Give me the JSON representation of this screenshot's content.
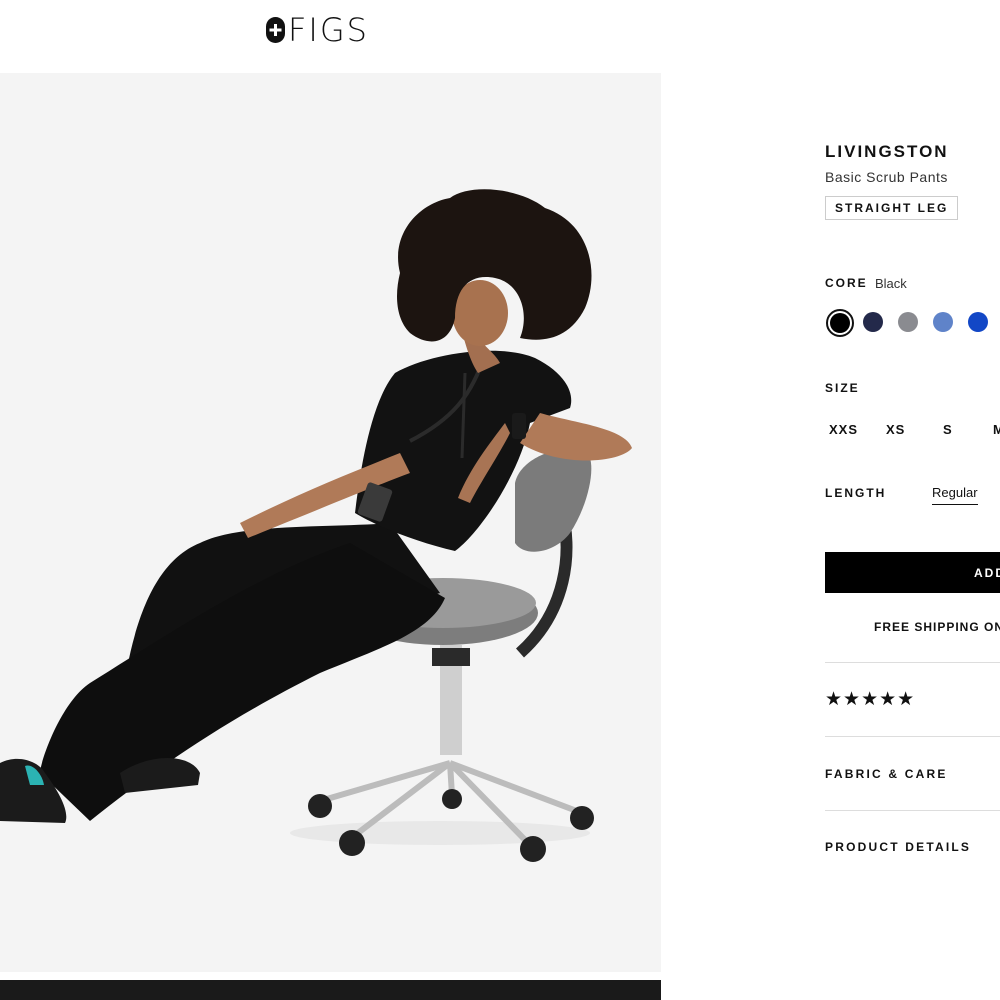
{
  "header": {
    "brand": "FIGS",
    "logo_icon": "figs-cross-logo-icon"
  },
  "product": {
    "name": "LIVINGSTON",
    "subtitle": "Basic Scrub Pants",
    "fit_badge": "STRAIGHT LEG",
    "image_alt": "model-seated-on-stool-photo"
  },
  "color": {
    "label": "CORE",
    "selected_name": "Black",
    "swatches": [
      {
        "name": "Black",
        "hex": "#000000",
        "selected": true
      },
      {
        "name": "Navy",
        "hex": "#23294a",
        "selected": false
      },
      {
        "name": "Graphite",
        "hex": "#8a8b90",
        "selected": false
      },
      {
        "name": "Ceil Blue",
        "hex": "#5f83c9",
        "selected": false
      },
      {
        "name": "Royal Blue",
        "hex": "#1247c6",
        "selected": false
      }
    ]
  },
  "size": {
    "label": "SIZE",
    "options": [
      "XXS",
      "XS",
      "S",
      "M"
    ]
  },
  "length": {
    "label": "LENGTH",
    "selected": "Regular"
  },
  "cart": {
    "add_label": "ADD",
    "shipping_text": "FREE SHIPPING ON"
  },
  "reviews": {
    "stars_text": "★★★★★",
    "rating": 5
  },
  "accordions": {
    "fabric_label": "FABRIC & CARE",
    "details_label": "PRODUCT DETAILS"
  }
}
